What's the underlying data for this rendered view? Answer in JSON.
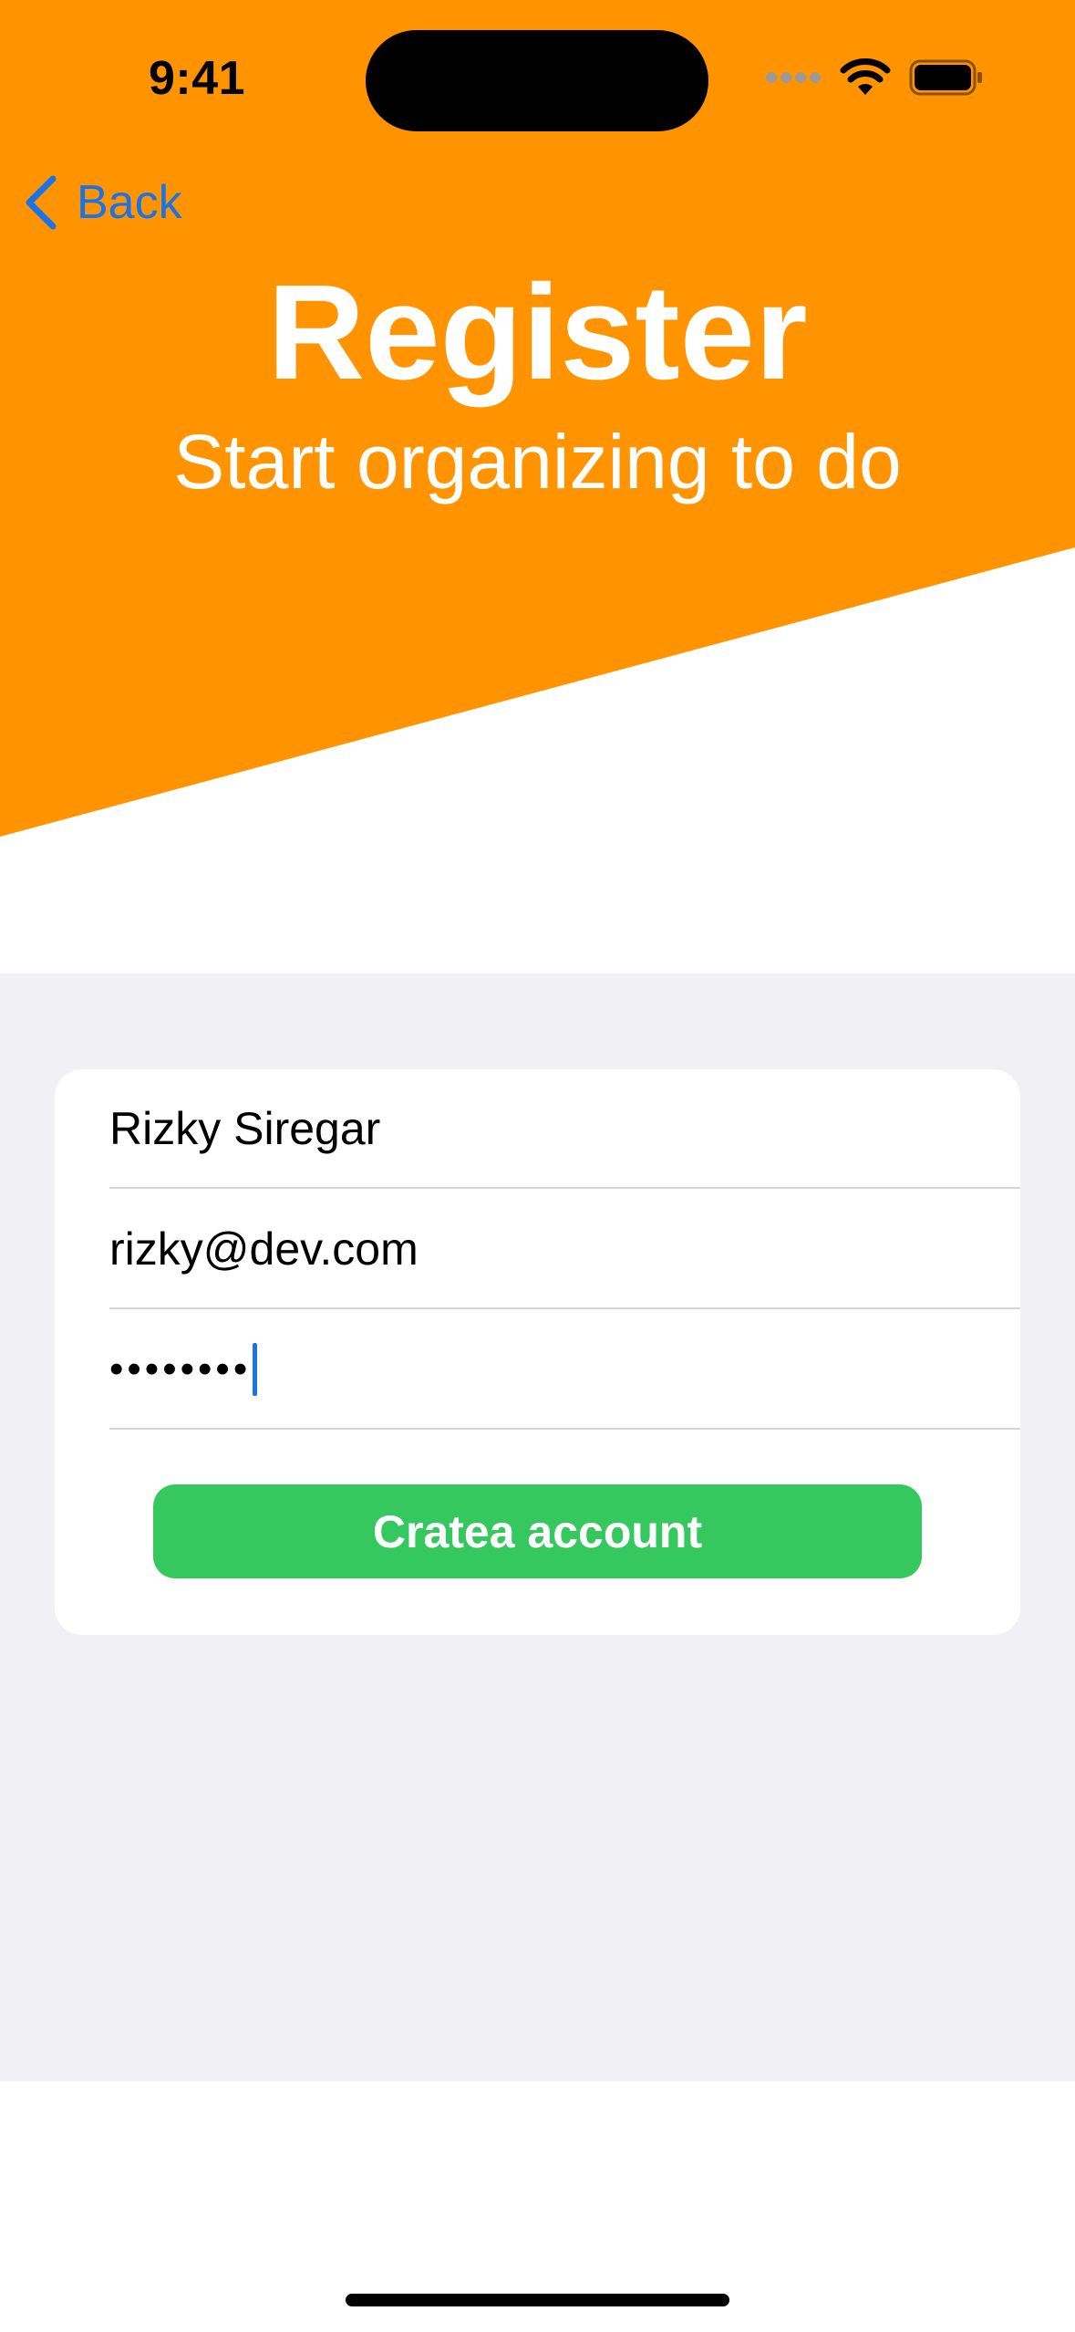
{
  "colors": {
    "header_orange": "#ff9400",
    "accent_blue": "#1a73e8",
    "button_green": "#35c85f",
    "form_background": "#f1f1f5"
  },
  "status_bar": {
    "time": "9:41",
    "icons": [
      "cellular-signal-icon",
      "wifi-icon",
      "battery-icon"
    ]
  },
  "nav": {
    "back_label": "Back",
    "back_icon": "chevron-left-icon"
  },
  "header": {
    "title": "Register",
    "subtitle": "Start organizing to do"
  },
  "form": {
    "name_value": "Rizky Siregar",
    "email_value": "rizky@dev.com",
    "password_value": "••••••••",
    "submit_label": "Cratea account"
  }
}
